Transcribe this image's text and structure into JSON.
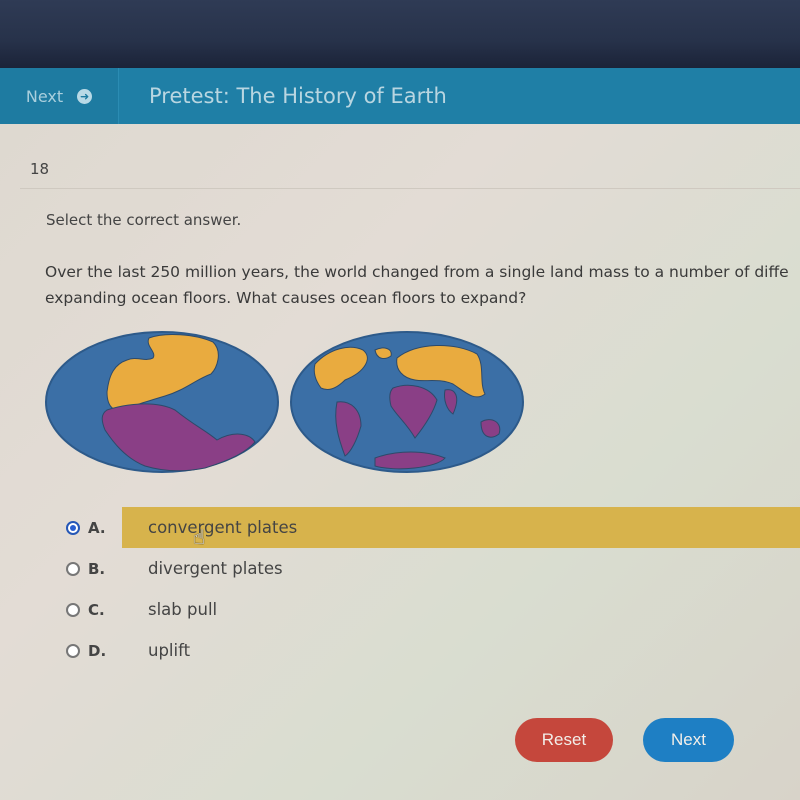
{
  "header": {
    "nav_next_label": "Next",
    "nav_next_icon": "arrow-right-circle-icon",
    "title": "Pretest: The History of Earth"
  },
  "question": {
    "number": "18",
    "instruction": "Select the correct answer.",
    "text": "Over the last 250 million years, the world changed from a single land mass to a number of different continents separated by expanding ocean floors. What causes ocean floors to expand?",
    "text_visible_line1": "Over the last 250 million years, the world changed from a single land mass to a number of diffe",
    "text_visible_line2": "expanding ocean floors. What causes ocean floors to expand?",
    "image": {
      "description": "Two oval world maps: Pangaea supercontinent (left) and present-day continents (right)",
      "colors": {
        "ocean": "#3b6fa6",
        "northern_land": "#e9ab3f",
        "southern_land": "#8a3f86"
      }
    }
  },
  "answers": [
    {
      "letter": "A.",
      "text": "convergent plates",
      "selected": true
    },
    {
      "letter": "B.",
      "text": "divergent plates",
      "selected": false
    },
    {
      "letter": "C.",
      "text": "slab pull",
      "selected": false
    },
    {
      "letter": "D.",
      "text": "uplift",
      "selected": false
    }
  ],
  "buttons": {
    "reset_label": "Reset",
    "next_label": "Next"
  },
  "colors": {
    "header": "#1f7fa6",
    "highlight": "#d7b34c",
    "reset": "#c5473c",
    "next": "#1e7fc4"
  }
}
